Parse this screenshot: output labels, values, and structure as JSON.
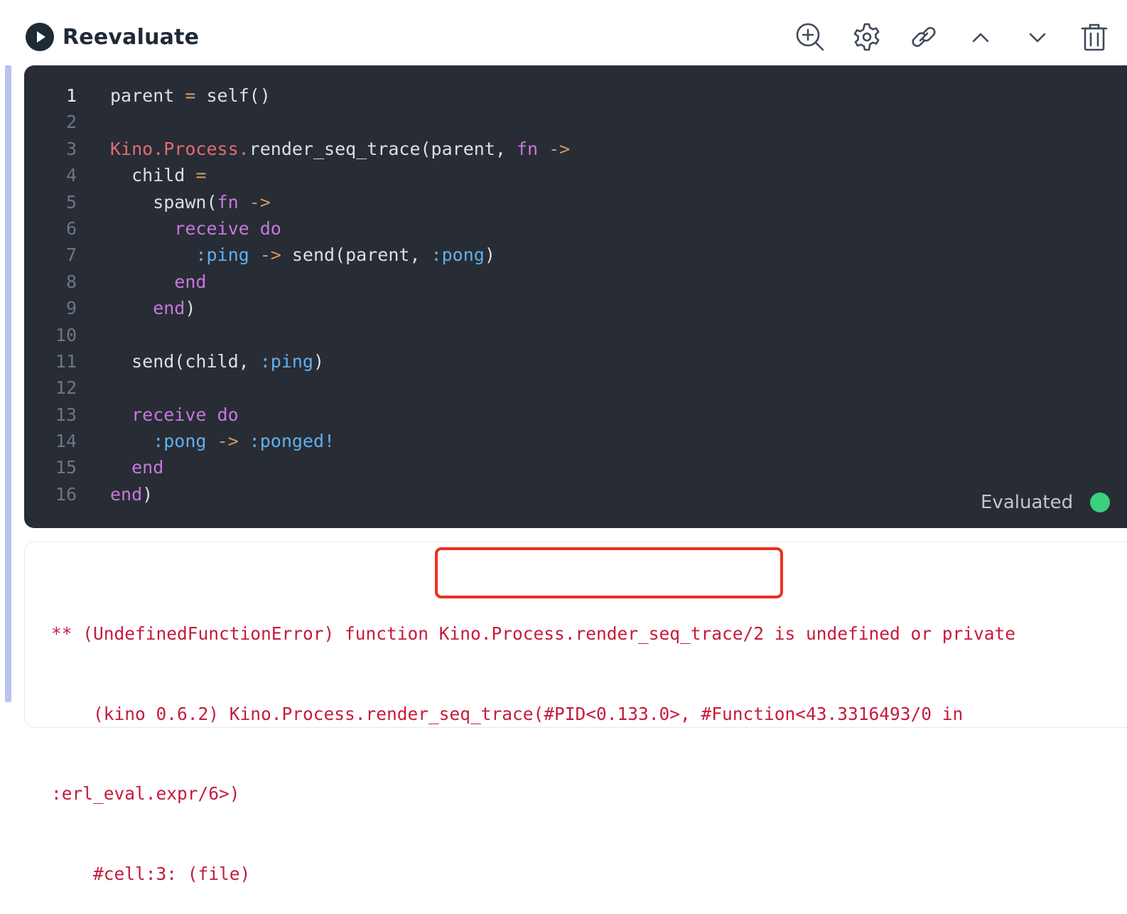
{
  "header": {
    "run_label": "Reevaluate",
    "run_icon": "play-circle-icon",
    "tools": [
      {
        "name": "zoom-in-icon"
      },
      {
        "name": "gear-icon"
      },
      {
        "name": "link-icon"
      },
      {
        "name": "chevron-up-icon"
      },
      {
        "name": "chevron-down-icon"
      },
      {
        "name": "trash-icon"
      }
    ]
  },
  "editor": {
    "line_numbers": [
      "1",
      "2",
      "3",
      "4",
      "5",
      "6",
      "7",
      "8",
      "9",
      "10",
      "11",
      "12",
      "13",
      "14",
      "15",
      "16"
    ],
    "active_line": 1,
    "lines": [
      [
        [
          "t-fn",
          "parent "
        ],
        [
          "t-op",
          "="
        ],
        [
          "t-fn",
          " self()"
        ]
      ],
      [],
      [
        [
          "t-mod",
          "Kino.Process."
        ],
        [
          "t-fn",
          "render_seq_trace(parent, "
        ],
        [
          "t-kw",
          "fn"
        ],
        [
          "t-op",
          " ->"
        ]
      ],
      [
        [
          "t-fn",
          "  child "
        ],
        [
          "t-op",
          "="
        ]
      ],
      [
        [
          "t-fn",
          "    spawn("
        ],
        [
          "t-kw",
          "fn"
        ],
        [
          "t-op",
          " ->"
        ]
      ],
      [
        [
          "t-kw",
          "      receive do"
        ]
      ],
      [
        [
          "t-atom",
          "        :ping"
        ],
        [
          "t-op",
          " ->"
        ],
        [
          "t-fn",
          " send(parent, "
        ],
        [
          "t-atom",
          ":pong"
        ],
        [
          "t-fn",
          ")"
        ]
      ],
      [
        [
          "t-kw",
          "      end"
        ]
      ],
      [
        [
          "t-kw",
          "    end"
        ],
        [
          "t-fn",
          ")"
        ]
      ],
      [],
      [
        [
          "t-fn",
          "  send(child, "
        ],
        [
          "t-atom",
          ":ping"
        ],
        [
          "t-fn",
          ")"
        ]
      ],
      [],
      [
        [
          "t-kw",
          "  receive do"
        ]
      ],
      [
        [
          "t-atom",
          "    :pong"
        ],
        [
          "t-op",
          " ->"
        ],
        [
          "t-atom",
          " :ponged!"
        ]
      ],
      [
        [
          "t-kw",
          "  end"
        ]
      ],
      [
        [
          "t-kw",
          "end"
        ],
        [
          "t-fn",
          ")"
        ]
      ]
    ],
    "status_text": "Evaluated",
    "status_color": "#3ad07c"
  },
  "output": {
    "lines": [
      "** (UndefinedFunctionError) function Kino.Process.render_seq_trace/2 is undefined or private",
      "    (kino 0.6.2) Kino.Process.render_seq_trace(#PID<0.133.0>, #Function<43.3316493/0 in",
      ":erl_eval.expr/6>)",
      "    #cell:3: (file)"
    ],
    "highlighted_text": "Kino.Process.render_seq_trace/2",
    "text_color": "#c51b3c",
    "highlight_color": "#e8331f"
  }
}
